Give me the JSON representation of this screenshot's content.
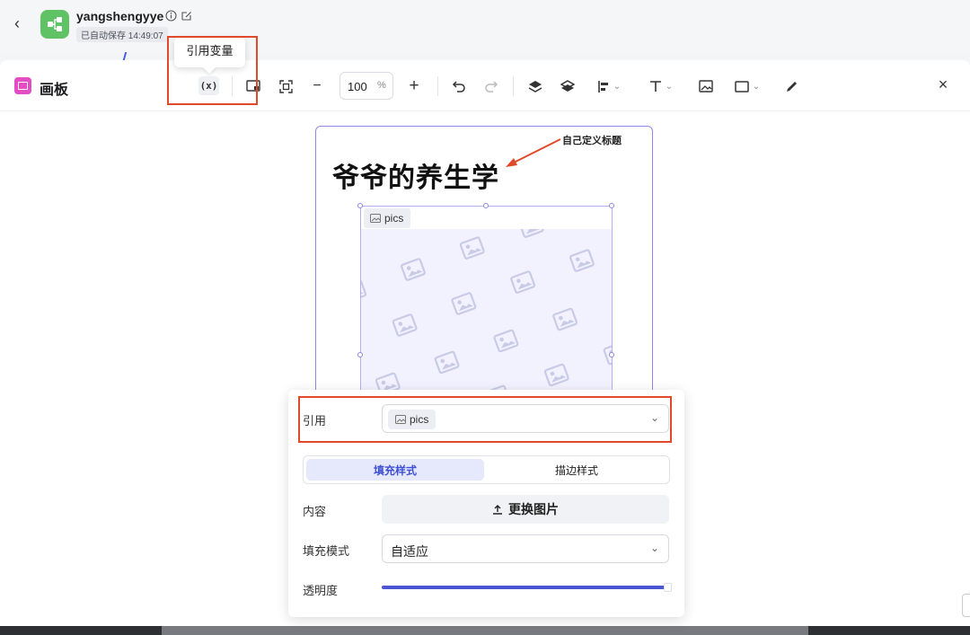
{
  "header": {
    "back_label": "‹",
    "app_name": "yangshengyye",
    "autosave": "已自动保存 14:49:07"
  },
  "panel": {
    "title": "画板",
    "close_label": "×"
  },
  "toolbar": {
    "variable_label": "(x)",
    "zoom_value": "100",
    "zoom_unit": "%",
    "zoom_out_label": "−",
    "zoom_in_label": "+",
    "tooltip": "引用变量"
  },
  "canvas": {
    "title": "爷爷的养生学",
    "annotation": "自己定义标题",
    "image_label": "pics"
  },
  "properties": {
    "ref_label": "引用",
    "ref_value": "pics",
    "tabs": [
      "填充样式",
      "描边样式"
    ],
    "content_label": "内容",
    "replace_button": "更换图片",
    "fill_mode_label": "填充模式",
    "fill_mode_value": "自适应",
    "opacity_label": "透明度",
    "opacity": 1.0
  },
  "colors": {
    "accent": "#4b55d3",
    "highlight": "#e04a2a",
    "app_icon": "#5fc265",
    "canvas_icon": "#e34cc2"
  }
}
